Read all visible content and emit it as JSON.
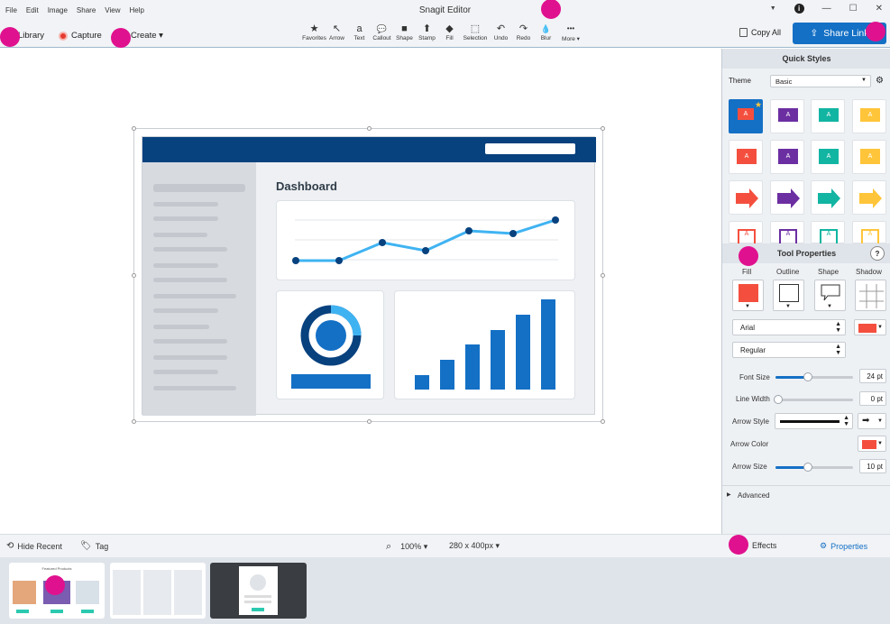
{
  "menu": [
    "File",
    "Edit",
    "Image",
    "Share",
    "View",
    "Help"
  ],
  "app_title": "Snagit Editor",
  "window_controls": {
    "minimize": "—",
    "maximize": "☐",
    "close": "✕"
  },
  "nav": {
    "library": "Library",
    "capture": "Capture",
    "create": "Create ▾"
  },
  "tools": [
    {
      "label": "Favorites",
      "icon": "★"
    },
    {
      "label": "Arrow",
      "icon": "↖"
    },
    {
      "label": "Text",
      "icon": "a"
    },
    {
      "label": "Callout",
      "icon": "💬"
    },
    {
      "label": "Shape",
      "icon": "■"
    },
    {
      "label": "Stamp",
      "icon": "⬆"
    },
    {
      "label": "Fill",
      "icon": "◆"
    },
    {
      "label": "Selection",
      "icon": "⬚"
    },
    {
      "label": "Undo",
      "icon": "↶"
    },
    {
      "label": "Redo",
      "icon": "↷"
    },
    {
      "label": "Blur",
      "icon": "💧"
    },
    {
      "label": "More ▾",
      "icon": "•••"
    }
  ],
  "copy_all": "Copy All",
  "share_link": "Share Link",
  "dashboard": {
    "title": "Dashboard"
  },
  "quick_styles": {
    "title": "Quick Styles",
    "theme_label": "Theme",
    "theme_value": "Basic",
    "style_letter": "A"
  },
  "tool_properties": {
    "title": "Tool Properties",
    "help": "?",
    "tabs": [
      "Fill",
      "Outline",
      "Shape",
      "Shadow"
    ],
    "font": "Arial",
    "weight": "Regular",
    "font_size_label": "Font Size",
    "font_size": "24 pt",
    "line_width_label": "Line Width",
    "line_width": "0 pt",
    "arrow_style_label": "Arrow Style",
    "arrow_color_label": "Arrow Color",
    "arrow_size_label": "Arrow Size",
    "arrow_size": "10 pt",
    "advanced": "Advanced"
  },
  "status": {
    "hide_recent": "Hide Recent",
    "tag": "Tag",
    "zoom": "100% ▾",
    "dimensions": "280 x 400px ▾",
    "effects": "Effects",
    "properties": "Properties"
  },
  "thumb1_title": "Featured Products",
  "colors": {
    "accent": "#1470c5",
    "fill": "#f44f3e",
    "navy": "#07417e"
  }
}
